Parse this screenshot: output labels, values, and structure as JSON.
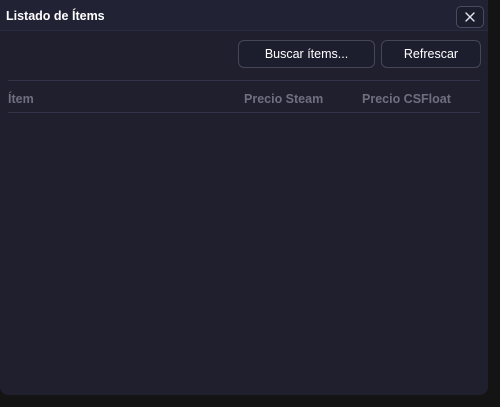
{
  "window": {
    "title": "Listado de Ítems"
  },
  "toolbar": {
    "search_label": "Buscar ítems...",
    "refresh_label": "Refrescar"
  },
  "table": {
    "columns": [
      "Ítem",
      "Precio Steam",
      "Precio CSFloat"
    ],
    "rows": []
  },
  "icons": {
    "close": "close-icon"
  },
  "colors": {
    "background": "#1f1f2e",
    "titlebar": "#212234",
    "header_text": "#6f6f80",
    "button_border": "#45465a"
  }
}
